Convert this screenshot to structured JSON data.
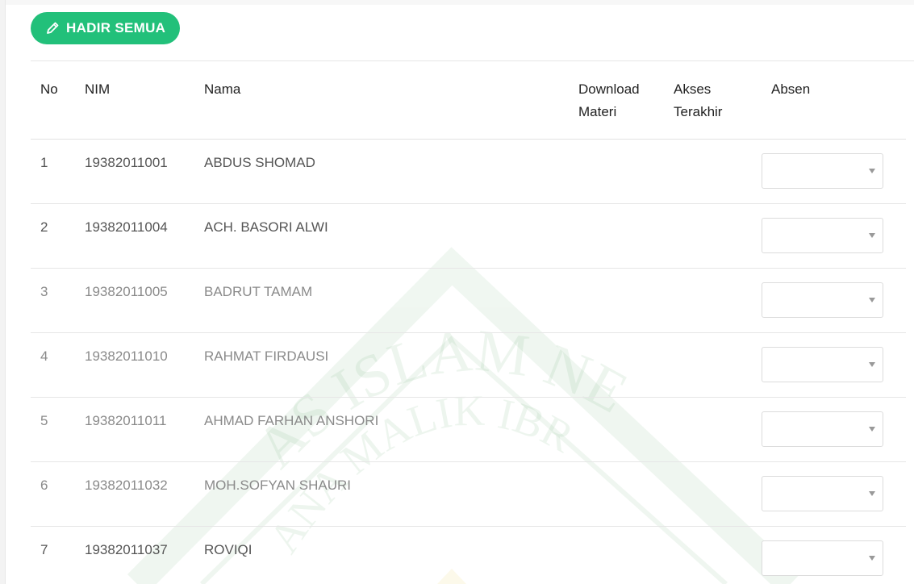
{
  "toolbar": {
    "hadir_label": "HADIR SEMUA",
    "hadir_icon": "pencil-icon",
    "button_color": "#22c07a"
  },
  "table": {
    "headers": {
      "no": "No",
      "nim": "NIM",
      "nama": "Nama",
      "download_line1": "Download",
      "download_line2": "Materi",
      "akses_line1": "Akses",
      "akses_line2": "Terakhir",
      "absen": "Absen"
    },
    "rows": [
      {
        "no": "1",
        "nim": "19382011001",
        "nama": "ABDUS SHOMAD",
        "download": "",
        "akses": "",
        "absen": ""
      },
      {
        "no": "2",
        "nim": "19382011004",
        "nama": "ACH. BASORI ALWI",
        "download": "",
        "akses": "",
        "absen": ""
      },
      {
        "no": "3",
        "nim": "19382011005",
        "nama": "BADRUT TAMAM",
        "download": "",
        "akses": "",
        "absen": ""
      },
      {
        "no": "4",
        "nim": "19382011010",
        "nama": "RAHMAT FIRDAUSI",
        "download": "",
        "akses": "",
        "absen": ""
      },
      {
        "no": "5",
        "nim": "19382011011",
        "nama": "AHMAD FARHAN ANSHORI",
        "download": "",
        "akses": "",
        "absen": ""
      },
      {
        "no": "6",
        "nim": "19382011032",
        "nama": "MOH.SOFYAN SHAURI",
        "download": "",
        "akses": "",
        "absen": ""
      },
      {
        "no": "7",
        "nim": "19382011037",
        "nama": "ROVIQI",
        "download": "",
        "akses": "",
        "absen": ""
      }
    ]
  },
  "watermark": {
    "arc_text": "AS ISLAM NE",
    "arc_text_inner": "ANA MALIK IBR",
    "color": "#2e8b3a"
  }
}
